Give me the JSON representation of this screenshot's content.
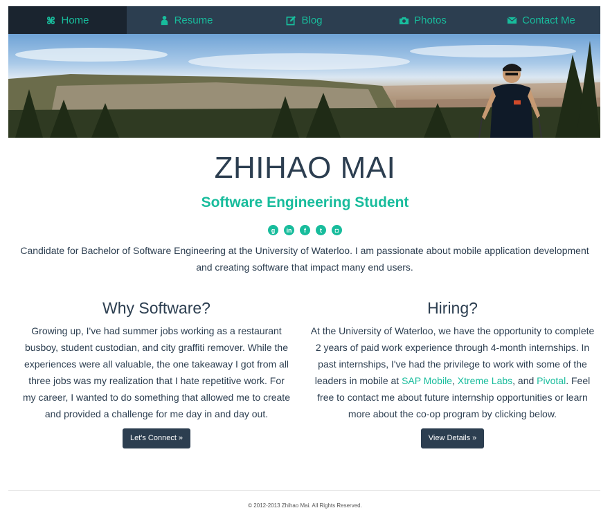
{
  "nav": {
    "items": [
      {
        "label": "Home",
        "icon": "command-icon",
        "active": true
      },
      {
        "label": "Resume",
        "icon": "user-icon",
        "active": false
      },
      {
        "label": "Blog",
        "icon": "edit-icon",
        "active": false
      },
      {
        "label": "Photos",
        "icon": "camera-icon",
        "active": false
      },
      {
        "label": "Contact Me",
        "icon": "envelope-icon",
        "active": false
      }
    ]
  },
  "hero": {
    "name": "ZHIHAO MAI",
    "subtitle": "Software Engineering Student",
    "socials": [
      {
        "name": "goodreads-icon",
        "glyph": "g"
      },
      {
        "name": "linkedin-icon",
        "glyph": "in"
      },
      {
        "name": "facebook-icon",
        "glyph": "f"
      },
      {
        "name": "twitter-icon",
        "glyph": "t"
      },
      {
        "name": "instagram-icon",
        "glyph": "◘"
      }
    ],
    "intro": "Candidate for Bachelor of Software Engineering at the University of Waterloo. I am passionate about mobile application development and creating software that impact many end users."
  },
  "why": {
    "heading": "Why Software?",
    "body": "Growing up, I've had summer jobs working as a restaurant busboy, student custodian, and city graffiti remover. While the experiences were all valuable, the one takeaway I got from all three jobs was my realization that I hate repetitive work. For my career, I wanted to do something that allowed me to create and provided a challenge for me day in and day out.",
    "button": "Let's Connect »"
  },
  "hiring": {
    "heading": "Hiring?",
    "body_before": "At the University of Waterloo, we have the opportunity to complete 2 years of paid work experience through 4-month internships. In past internships, I've had the privilege to work with some of the leaders in mobile at ",
    "link1": "SAP Mobile",
    "sep1": ", ",
    "link2": "Xtreme Labs",
    "sep2": ", and ",
    "link3": "Pivotal",
    "body_after": ". Feel free to contact me about future internship opportunities or learn more about the co-op program by clicking below.",
    "button": "View Details »"
  },
  "footer": {
    "text": "© 2012-2013 Zhihao Mai. All Rights Reserved."
  },
  "colors": {
    "primary": "#2c3e50",
    "accent": "#18bc9c",
    "nav_active": "#1a242f"
  }
}
